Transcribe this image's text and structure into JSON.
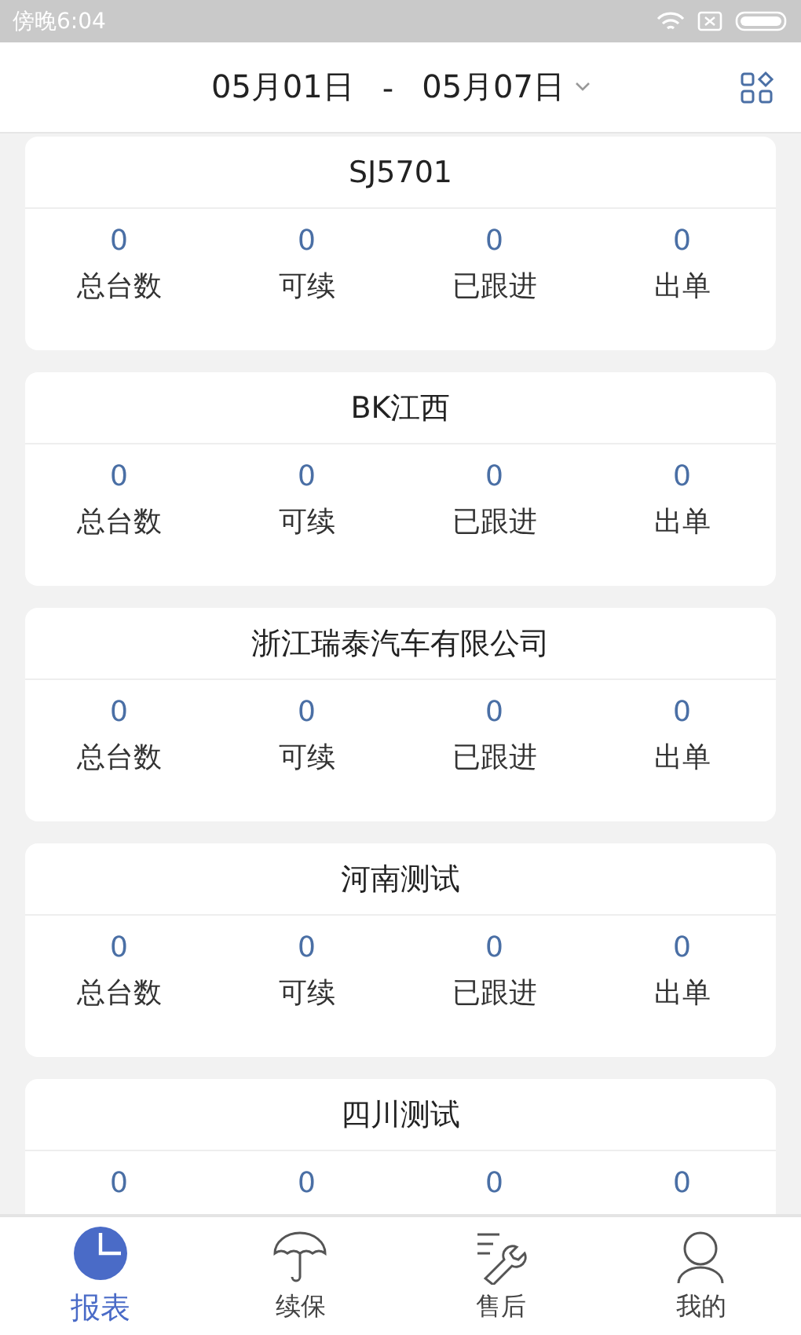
{
  "status_bar": {
    "time": "傍晚6:04"
  },
  "header": {
    "date_start": "05月01日",
    "separator": "-",
    "date_end": "05月07日"
  },
  "cards": [
    {
      "title": "SJ5701",
      "stats": [
        {
          "value": "0",
          "label": "总台数"
        },
        {
          "value": "0",
          "label": "可续"
        },
        {
          "value": "0",
          "label": "已跟进"
        },
        {
          "value": "0",
          "label": "出单"
        }
      ]
    },
    {
      "title": "BK江西",
      "stats": [
        {
          "value": "0",
          "label": "总台数"
        },
        {
          "value": "0",
          "label": "可续"
        },
        {
          "value": "0",
          "label": "已跟进"
        },
        {
          "value": "0",
          "label": "出单"
        }
      ]
    },
    {
      "title": "浙江瑞泰汽车有限公司",
      "stats": [
        {
          "value": "0",
          "label": "总台数"
        },
        {
          "value": "0",
          "label": "可续"
        },
        {
          "value": "0",
          "label": "已跟进"
        },
        {
          "value": "0",
          "label": "出单"
        }
      ]
    },
    {
      "title": "河南测试",
      "stats": [
        {
          "value": "0",
          "label": "总台数"
        },
        {
          "value": "0",
          "label": "可续"
        },
        {
          "value": "0",
          "label": "已跟进"
        },
        {
          "value": "0",
          "label": "出单"
        }
      ]
    },
    {
      "title": "四川测试",
      "stats": [
        {
          "value": "0"
        },
        {
          "value": "0"
        },
        {
          "value": "0"
        },
        {
          "value": "0"
        }
      ]
    }
  ],
  "tabs": [
    {
      "kind": "chart",
      "label": "报表",
      "selected": true
    },
    {
      "kind": "umbrella",
      "label": "续保",
      "selected": false
    },
    {
      "kind": "tools",
      "label": "售后",
      "selected": false
    },
    {
      "kind": "person",
      "label": "我的",
      "selected": false
    }
  ]
}
